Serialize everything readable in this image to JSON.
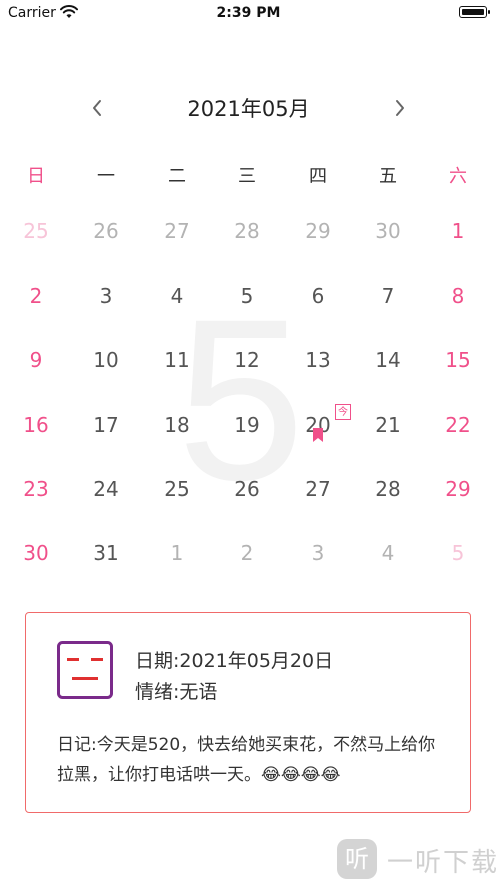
{
  "status_bar": {
    "carrier": "Carrier",
    "time": "2:39 PM"
  },
  "calendar": {
    "month_title": "2021年05月",
    "watermark_month": "5",
    "today_badge": "今",
    "today_date": "20",
    "accent_color": "#f0508a",
    "weekdays": [
      "日",
      "一",
      "二",
      "三",
      "四",
      "五",
      "六"
    ],
    "weeks": [
      [
        "25",
        "26",
        "27",
        "28",
        "29",
        "30",
        "1"
      ],
      [
        "2",
        "3",
        "4",
        "5",
        "6",
        "7",
        "8"
      ],
      [
        "9",
        "10",
        "11",
        "12",
        "13",
        "14",
        "15"
      ],
      [
        "16",
        "17",
        "18",
        "19",
        "20",
        "21",
        "22"
      ],
      [
        "23",
        "24",
        "25",
        "26",
        "27",
        "28",
        "29"
      ],
      [
        "30",
        "31",
        "1",
        "2",
        "3",
        "4",
        "5"
      ]
    ],
    "other_month_flags": [
      [
        true,
        true,
        true,
        true,
        true,
        true,
        false
      ],
      [
        false,
        false,
        false,
        false,
        false,
        false,
        false
      ],
      [
        false,
        false,
        false,
        false,
        false,
        false,
        false
      ],
      [
        false,
        false,
        false,
        false,
        false,
        false,
        false
      ],
      [
        false,
        false,
        false,
        false,
        false,
        false,
        false
      ],
      [
        false,
        false,
        true,
        true,
        true,
        true,
        true
      ]
    ]
  },
  "diary": {
    "date_line": "日期:2021年05月20日",
    "mood_line": "情绪:无语",
    "text": "日记:今天是520，快去给她买束花，不然马上给你拉黑，让你打电话哄一天。😂😂😂😂",
    "border_color": "#f06a6a",
    "mood_icon": "speechless-face-icon"
  },
  "watermark_logo": {
    "text": "一听下载",
    "mark": "听"
  }
}
